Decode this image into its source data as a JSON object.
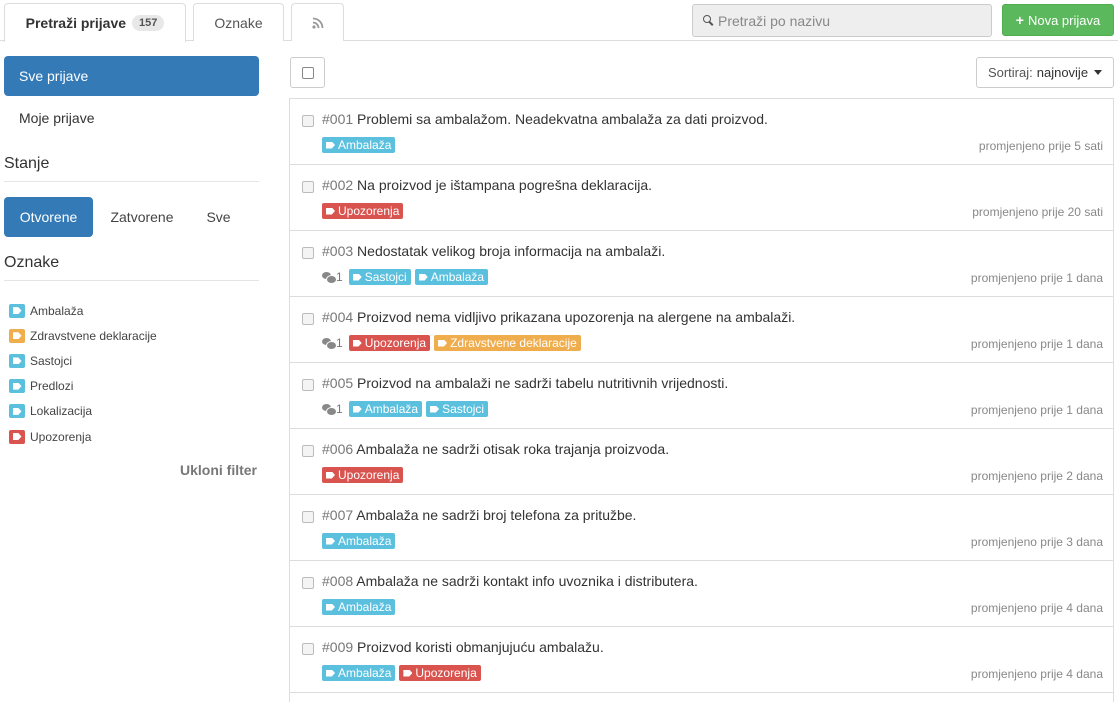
{
  "tabs": {
    "prijave_label": "Pretraži prijave",
    "prijave_count": "157",
    "oznake_label": "Oznake"
  },
  "search": {
    "placeholder": "Pretraži po nazivu"
  },
  "new_button": {
    "label": "Nova prijava"
  },
  "sidebar": {
    "all_label": "Sve prijave",
    "mine_label": "Moje prijave",
    "state_heading": "Stanje",
    "states": [
      "Otvorene",
      "Zatvorene",
      "Sve"
    ],
    "tags_heading": "Oznake",
    "tags": [
      {
        "label": "Ambalaža",
        "color": "#5bc0de"
      },
      {
        "label": "Zdravstvene deklaracije",
        "color": "#f0ad4e"
      },
      {
        "label": "Sastojci",
        "color": "#5bc0de"
      },
      {
        "label": "Predlozi",
        "color": "#5bc0de"
      },
      {
        "label": "Lokalizacija",
        "color": "#5bc0de"
      },
      {
        "label": "Upozorenja",
        "color": "#d9534f"
      }
    ],
    "clear_filter": "Ukloni filter"
  },
  "sort": {
    "prefix": "Sortiraj:",
    "value": "najnovije"
  },
  "issues": [
    {
      "num": "#001",
      "title": "Problemi sa ambalažom. Neadekvatna ambalaža za dati proizvod.",
      "comments": "",
      "tags": [
        {
          "label": "Ambalaža",
          "color": "blue"
        }
      ],
      "time": "promjenjeno prije 5 sati"
    },
    {
      "num": "#002",
      "title": "Na proizvod je ištampana pogrešna deklaracija.",
      "comments": "",
      "tags": [
        {
          "label": "Upozorenja",
          "color": "red"
        }
      ],
      "time": "promjenjeno prije 20 sati"
    },
    {
      "num": "#003",
      "title": "Nedostatak velikog broja informacija na ambalaži.",
      "comments": "1",
      "tags": [
        {
          "label": "Sastojci",
          "color": "blue"
        },
        {
          "label": "Ambalaža",
          "color": "blue"
        }
      ],
      "time": "promjenjeno prije 1 dana"
    },
    {
      "num": "#004",
      "title": "Proizvod nema vidljivo prikazana upozorenja na alergene na ambalaži.",
      "comments": "1",
      "tags": [
        {
          "label": "Upozorenja",
          "color": "red"
        },
        {
          "label": "Zdravstvene deklaracije",
          "color": "orange"
        }
      ],
      "time": "promjenjeno prije 1 dana"
    },
    {
      "num": "#005",
      "title": "Proizvod na ambalaži ne sadrži tabelu nutritivnih vrijednosti.",
      "comments": "1",
      "tags": [
        {
          "label": "Ambalaža",
          "color": "blue"
        },
        {
          "label": "Sastojci",
          "color": "blue"
        }
      ],
      "time": "promjenjeno prije 1 dana"
    },
    {
      "num": "#006",
      "title": "Ambalaža ne sadrži otisak roka trajanja proizvoda.",
      "comments": "",
      "tags": [
        {
          "label": "Upozorenja",
          "color": "red"
        }
      ],
      "time": "promjenjeno prije 2 dana"
    },
    {
      "num": "#007",
      "title": "Ambalaža ne sadrži broj telefona za pritužbe.",
      "comments": "",
      "tags": [
        {
          "label": "Ambalaža",
          "color": "blue"
        }
      ],
      "time": "promjenjeno prije 3 dana"
    },
    {
      "num": "#008",
      "title": "Ambalaža ne sadrži kontakt info uvoznika i distributera.",
      "comments": "",
      "tags": [
        {
          "label": "Ambalaža",
          "color": "blue"
        }
      ],
      "time": "promjenjeno prije 4 dana"
    },
    {
      "num": "#009",
      "title": "Proizvod koristi obmanjujuću ambalažu.",
      "comments": "",
      "tags": [
        {
          "label": "Ambalaža",
          "color": "blue"
        },
        {
          "label": "Upozorenja",
          "color": "red"
        }
      ],
      "time": "promjenjeno prije 4 dana"
    }
  ]
}
